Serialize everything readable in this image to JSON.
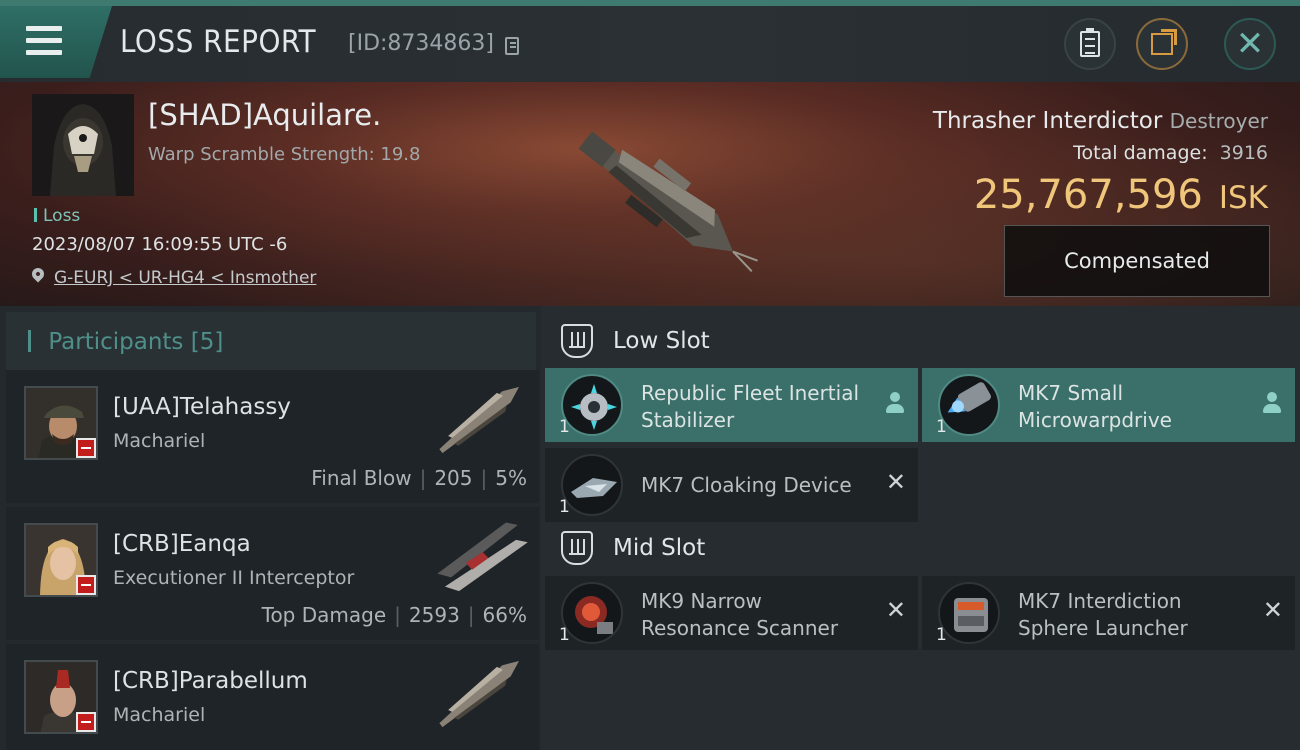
{
  "header": {
    "title": "LOSS REPORT",
    "report_id": "[ID:8734863]",
    "icons": [
      "menu-icon",
      "copy-icon",
      "clipboard-icon",
      "share-icon",
      "close-icon"
    ]
  },
  "victim": {
    "name": "[SHAD]Aquilare.",
    "warp_scramble": "Warp Scramble Strength: 19.8",
    "result": "Loss",
    "datetime": "2023/08/07 16:09:55 UTC -6",
    "location": "G-EURJ < UR-HG4 < Insmother",
    "ship_name": "Thrasher Interdictor",
    "ship_class": "Destroyer",
    "total_damage_label": "Total damage:",
    "total_damage": "3916",
    "isk_value": "25,767,596",
    "isk_unit": "ISK",
    "compensated_label": "Compensated"
  },
  "participants": {
    "title": "Participants",
    "count": "[5]",
    "rows": [
      {
        "name": "[UAA]Telahassy",
        "ship": "Machariel",
        "role": "Final Blow",
        "damage": "205",
        "percent": "5%"
      },
      {
        "name": "[CRB]Eanqa",
        "ship": "Executioner II Interceptor",
        "role": "Top Damage",
        "damage": "2593",
        "percent": "66%"
      },
      {
        "name": "[CRB]Parabellum",
        "ship": "Machariel"
      }
    ]
  },
  "slots": {
    "low": {
      "label": "Low Slot",
      "items": [
        {
          "name": "Republic Fleet Inertial Stabilizer",
          "qty": "1",
          "status": "dropped"
        },
        {
          "name": "MK7 Small Microwarpdrive",
          "qty": "1",
          "status": "dropped"
        },
        {
          "name": "MK7 Cloaking Device",
          "qty": "1",
          "status": "destroyed"
        }
      ]
    },
    "mid": {
      "label": "Mid Slot",
      "items": [
        {
          "name": "MK9 Narrow Resonance Scanner",
          "qty": "1",
          "status": "destroyed"
        },
        {
          "name": "MK7 Interdiction Sphere Launcher",
          "qty": "1",
          "status": "destroyed"
        }
      ]
    }
  },
  "colors": {
    "accent_teal": "#3b6f69",
    "isk_gold": "#f0c67a",
    "loss_red": "#c21c1c"
  }
}
